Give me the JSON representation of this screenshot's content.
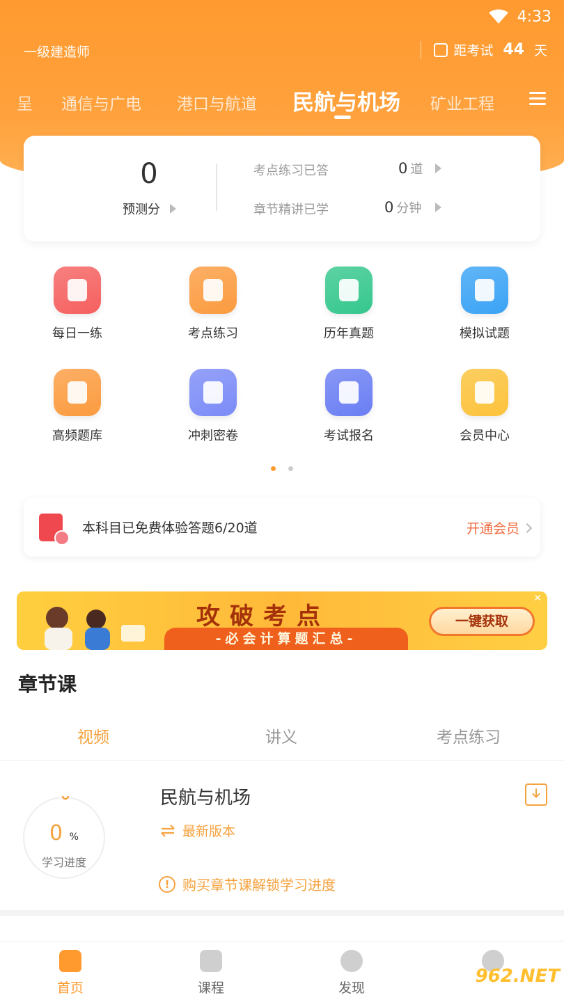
{
  "status_bar": {
    "time": "4:33"
  },
  "header": {
    "exam_type": "一级建造师",
    "countdown_prefix": "距考试",
    "countdown_days": "44",
    "countdown_unit": "天"
  },
  "subject_tabs": [
    "呈",
    "通信与广电",
    "港口与航道",
    "民航与机场",
    "矿业工程"
  ],
  "active_subject": "民航与机场",
  "stats": {
    "score": "0",
    "score_label": "预测分",
    "practice_label": "考点练习已答",
    "practice_value": "0",
    "practice_unit": "道",
    "lecture_label": "章节精讲已学",
    "lecture_value": "0",
    "lecture_unit": "分钟"
  },
  "grid": [
    {
      "label": "每日一练",
      "icon": "daily-practice-icon",
      "color": "#f5605f"
    },
    {
      "label": "考点练习",
      "icon": "key-point-icon",
      "color": "#fb9b3f"
    },
    {
      "label": "历年真题",
      "icon": "past-exams-icon",
      "color": "#35c78d"
    },
    {
      "label": "模拟试题",
      "icon": "mock-test-icon",
      "color": "#3aa3f5"
    },
    {
      "label": "高频题库",
      "icon": "high-frequency-icon",
      "color": "#fb9b3f"
    },
    {
      "label": "冲刺密卷",
      "icon": "sprint-paper-icon",
      "color": "#7b8bf7"
    },
    {
      "label": "考试报名",
      "icon": "registration-icon",
      "color": "#6a7ef3"
    },
    {
      "label": "会员中心",
      "icon": "vip-crown-icon",
      "color": "#fcc23a"
    }
  ],
  "trial": {
    "text": "本科目已免费体验答题6/20道",
    "link": "开通会员"
  },
  "banner": {
    "title": "攻破考点",
    "subtitle": "-必会计算题汇总-",
    "button": "一键获取",
    "close": "✕"
  },
  "section": {
    "title": "章节课",
    "tabs": [
      "视频",
      "讲义",
      "考点练习"
    ]
  },
  "course": {
    "progress_value": "0",
    "progress_unit": "%",
    "progress_label": "学习进度",
    "name": "民航与机场",
    "version": "最新版本",
    "unlock": "购买章节课解锁学习进度"
  },
  "bottom_nav": [
    "首页",
    "课程",
    "发现",
    ""
  ],
  "watermark": "962.NET",
  "colors": {
    "brand": "#ff9a2f",
    "accent_text": "#f5a23e",
    "vip_link": "#f06a3c"
  }
}
